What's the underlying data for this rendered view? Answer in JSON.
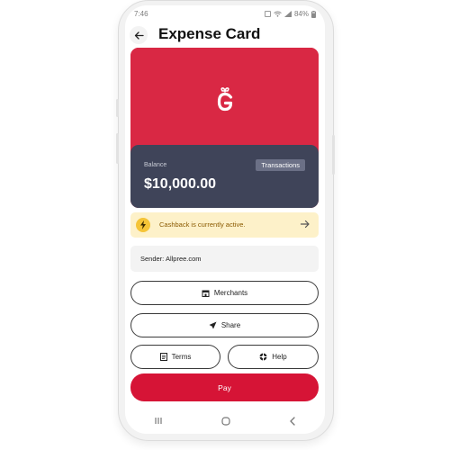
{
  "status_bar": {
    "time": "7:46",
    "battery": "84%"
  },
  "header": {
    "title": "Expense Card"
  },
  "card": {
    "balance_label": "Balance",
    "balance_value": "$10,000.00",
    "transactions_label": "Transactions"
  },
  "cashback": {
    "text": "Cashback is currently active."
  },
  "sender": {
    "text": "Sender: Allpree.com"
  },
  "actions": {
    "merchants": "Merchants",
    "share": "Share",
    "terms": "Terms",
    "help": "Help",
    "pay": "Pay"
  },
  "colors": {
    "card_red": "#d92844",
    "card_dark": "#3f4459",
    "cashback_bg": "#fdf1c9",
    "pay_red": "#d61436"
  }
}
